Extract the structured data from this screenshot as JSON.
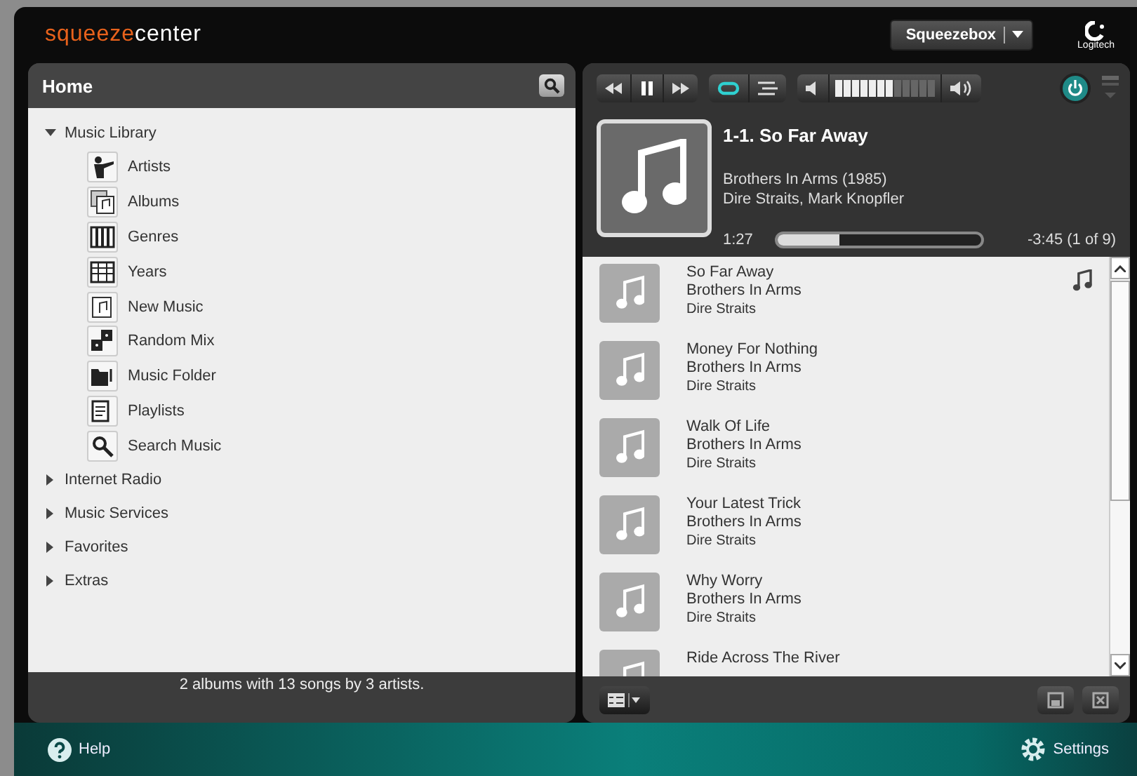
{
  "header": {
    "logo_part_1": "squeeze",
    "logo_part_2": "center",
    "player_select": "Squeezebox",
    "brand": "Logitech"
  },
  "home": {
    "title": "Home",
    "tree": [
      {
        "label": "Music Library",
        "expanded": true,
        "children": [
          {
            "label": "Artists",
            "kind": "artists"
          },
          {
            "label": "Albums",
            "kind": "albums"
          },
          {
            "label": "Genres",
            "kind": "genres"
          },
          {
            "label": "Years",
            "kind": "years"
          },
          {
            "label": "New Music",
            "kind": "newmusic"
          },
          {
            "label": "Random Mix",
            "kind": "random"
          },
          {
            "label": "Music Folder",
            "kind": "folder"
          },
          {
            "label": "Playlists",
            "kind": "playlists"
          },
          {
            "label": "Search Music",
            "kind": "search"
          }
        ]
      },
      {
        "label": "Internet Radio",
        "expanded": false
      },
      {
        "label": "Music Services",
        "expanded": false
      },
      {
        "label": "Favorites",
        "expanded": false
      },
      {
        "label": "Extras",
        "expanded": false
      }
    ],
    "status": "2 albums with 13 songs by 3 artists."
  },
  "controls": {
    "playing": true,
    "repeat_on": true,
    "volume": {
      "level": 0.58
    },
    "power_on": true
  },
  "now_playing": {
    "title": "1-1. So Far Away",
    "album": "Brothers In Arms (1985)",
    "artist": "Dire Straits, Mark Knopfler",
    "elapsed": "1:27",
    "progress": {
      "level": 0.3
    },
    "remaining": "-3:45 (1 of 9)"
  },
  "playlist": [
    {
      "title": "So Far Away",
      "album": "Brothers In Arms",
      "artist": "Dire Straits",
      "playing": true
    },
    {
      "title": "Money For Nothing",
      "album": "Brothers In Arms",
      "artist": "Dire Straits",
      "playing": false
    },
    {
      "title": "Walk Of Life",
      "album": "Brothers In Arms",
      "artist": "Dire Straits",
      "playing": false
    },
    {
      "title": "Your Latest Trick",
      "album": "Brothers In Arms",
      "artist": "Dire Straits",
      "playing": false
    },
    {
      "title": "Why Worry",
      "album": "Brothers In Arms",
      "artist": "Dire Straits",
      "playing": false
    },
    {
      "title": "Ride Across The River",
      "playing": false
    }
  ],
  "footer": {
    "help": "Help",
    "settings": "Settings"
  }
}
